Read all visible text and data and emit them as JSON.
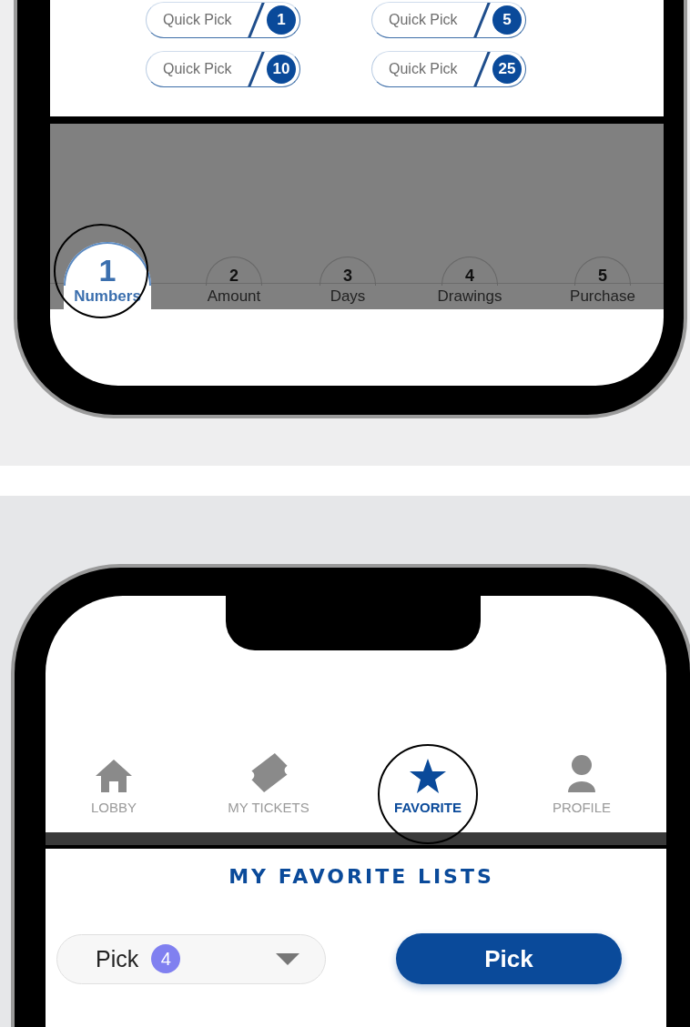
{
  "quick_picks": [
    {
      "label": "Quick Pick",
      "count": "1"
    },
    {
      "label": "Quick Pick",
      "count": "5"
    },
    {
      "label": "Quick Pick",
      "count": "10"
    },
    {
      "label": "Quick Pick",
      "count": "25"
    }
  ],
  "steps": [
    {
      "number": "1",
      "label": "Numbers",
      "selected": true
    },
    {
      "number": "2",
      "label": "Amount",
      "selected": false
    },
    {
      "number": "3",
      "label": "Days",
      "selected": false
    },
    {
      "number": "4",
      "label": "Drawings",
      "selected": false
    },
    {
      "number": "5",
      "label": "Purchase",
      "selected": false
    }
  ],
  "nav_tabs": [
    {
      "kind": "house",
      "label": "LOBBY",
      "selected": false
    },
    {
      "kind": "ticket",
      "label": "MY TICKETS",
      "selected": false
    },
    {
      "kind": "star",
      "label": "FAVORITE",
      "selected": true
    },
    {
      "kind": "person",
      "label": "PROFILE",
      "selected": false
    }
  ],
  "favorites": {
    "title": "MY FAVORITE LISTS",
    "dropdown": {
      "value": "Pick",
      "badge": "4"
    },
    "button": "Pick"
  }
}
